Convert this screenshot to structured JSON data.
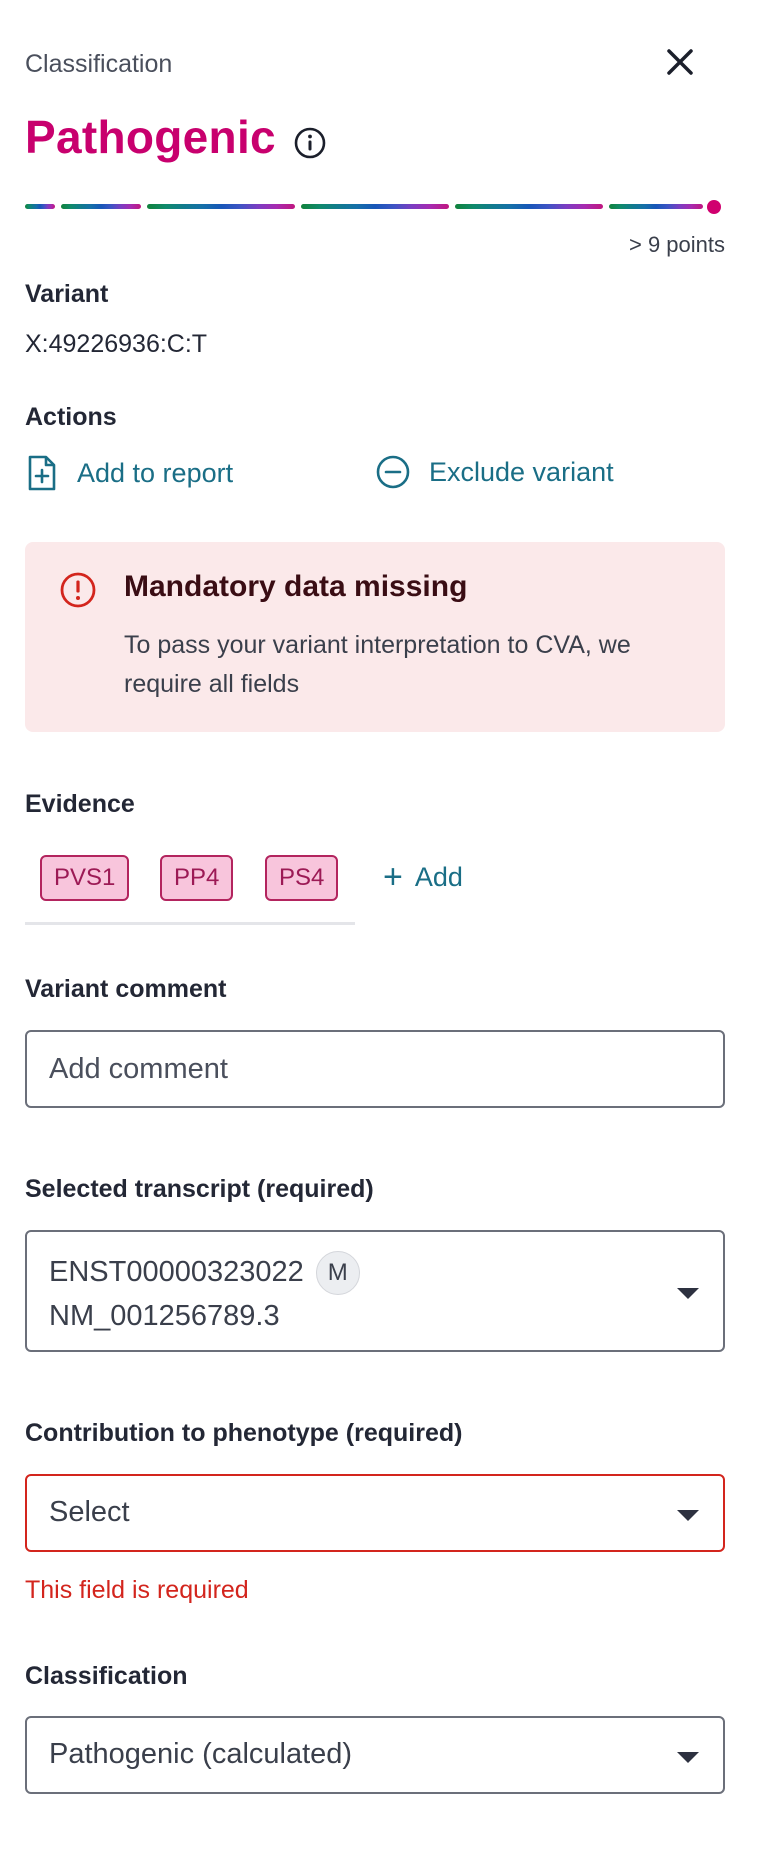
{
  "header": {
    "eyebrow": "Classification",
    "title": "Pathogenic",
    "points_text": "> 9 points"
  },
  "scale": {
    "segment_colors": [
      "#11823b",
      "#0f8a6b",
      "#117b8d",
      "#1570a8",
      "#1757b8",
      "#3d54c4",
      "#7b3dc2",
      "#a72ab0",
      "#c0177f"
    ],
    "marker_color": "#d0006f"
  },
  "variant": {
    "label": "Variant",
    "value": "X:49226936:C:T"
  },
  "actions": {
    "label": "Actions",
    "add_to_report": "Add to report",
    "exclude_variant": "Exclude variant"
  },
  "alert": {
    "title": "Mandatory data missing",
    "body": "To pass your variant interpretation to CVA, we require all fields"
  },
  "evidence": {
    "label": "Evidence",
    "chips": [
      "PVS1",
      "PP4",
      "PS4"
    ],
    "add_label": "Add"
  },
  "variant_comment": {
    "label": "Variant comment",
    "placeholder": "Add comment"
  },
  "transcript": {
    "label": "Selected transcript (required)",
    "line1": "ENST00000323022",
    "badge": "M",
    "line2": "NM_001256789.3"
  },
  "contribution": {
    "label": "Contribution to phenotype (required)",
    "value": "Select",
    "error": "This field is required"
  },
  "classification": {
    "label": "Classification",
    "value": "Pathogenic (calculated)"
  }
}
